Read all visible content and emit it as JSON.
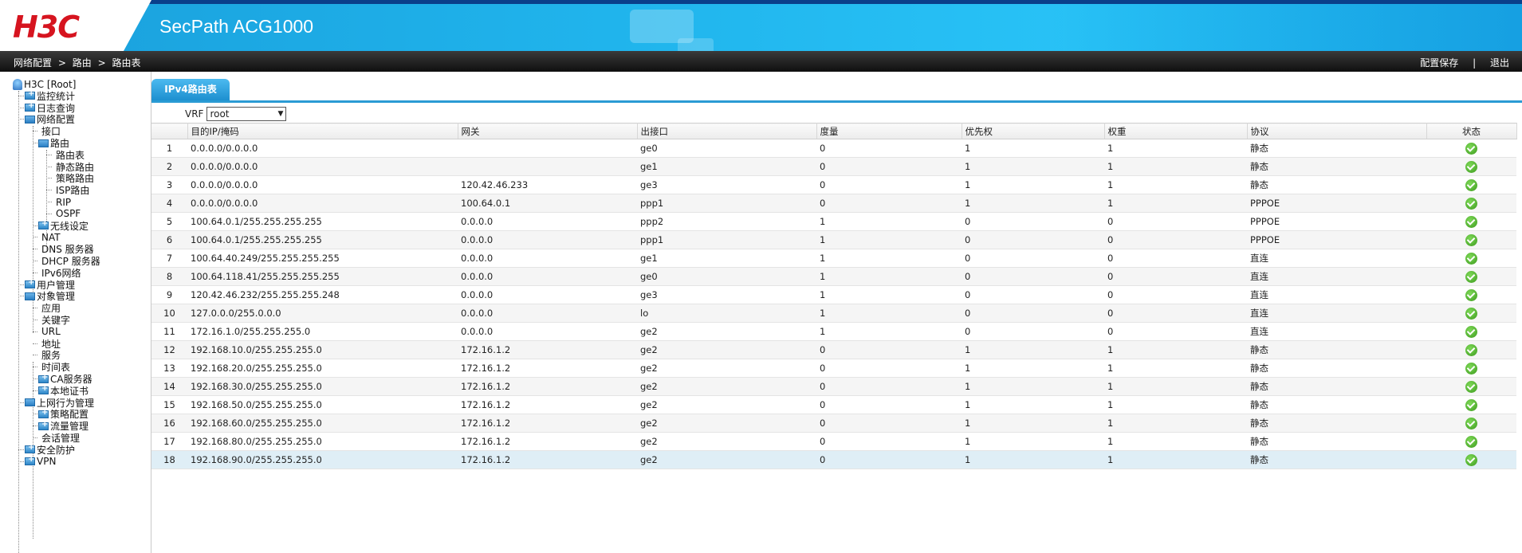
{
  "header": {
    "logo": "H3C",
    "product": "SecPath ACG1000"
  },
  "navbar": {
    "breadcrumb": [
      "网络配置",
      "路由",
      "路由表"
    ],
    "breadcrumb_sep": ">",
    "save_config": "配置保存",
    "divider": "|",
    "logout": "退出"
  },
  "sidebar": {
    "items": [
      {
        "label": "H3C [Root]",
        "icon": "root-icon"
      },
      {
        "label": "监控统计",
        "icon": "folder-plus-icon"
      },
      {
        "label": "日志查询",
        "icon": "folder-plus-icon"
      },
      {
        "label": "网络配置",
        "icon": "folder-open-icon"
      },
      {
        "label": "接口",
        "icon": "none"
      },
      {
        "label": "路由",
        "icon": "folder-open-icon"
      },
      {
        "label": "路由表",
        "icon": "none"
      },
      {
        "label": "静态路由",
        "icon": "none"
      },
      {
        "label": "策略路由",
        "icon": "none"
      },
      {
        "label": "ISP路由",
        "icon": "none"
      },
      {
        "label": "RIP",
        "icon": "none"
      },
      {
        "label": "OSPF",
        "icon": "none"
      },
      {
        "label": "无线设定",
        "icon": "folder-plus-icon"
      },
      {
        "label": "NAT",
        "icon": "none"
      },
      {
        "label": "DNS 服务器",
        "icon": "none"
      },
      {
        "label": "DHCP 服务器",
        "icon": "none"
      },
      {
        "label": "IPv6网络",
        "icon": "none"
      },
      {
        "label": "用户管理",
        "icon": "folder-plus-icon"
      },
      {
        "label": "对象管理",
        "icon": "folder-open-icon"
      },
      {
        "label": "应用",
        "icon": "none"
      },
      {
        "label": "关键字",
        "icon": "none"
      },
      {
        "label": "URL",
        "icon": "none"
      },
      {
        "label": "地址",
        "icon": "none"
      },
      {
        "label": "服务",
        "icon": "none"
      },
      {
        "label": "时间表",
        "icon": "none"
      },
      {
        "label": "CA服务器",
        "icon": "folder-plus-icon"
      },
      {
        "label": "本地证书",
        "icon": "folder-plus-icon"
      },
      {
        "label": "上网行为管理",
        "icon": "folder-open-icon"
      },
      {
        "label": "策略配置",
        "icon": "folder-plus-icon"
      },
      {
        "label": "流量管理",
        "icon": "folder-plus-icon"
      },
      {
        "label": "会话管理",
        "icon": "none"
      },
      {
        "label": "安全防护",
        "icon": "folder-plus-icon"
      },
      {
        "label": "VPN",
        "icon": "folder-plus-icon"
      }
    ]
  },
  "tab": {
    "label": "IPv4路由表"
  },
  "vrf": {
    "label": "VRF",
    "selected": "root"
  },
  "table": {
    "columns": [
      "",
      "目的IP/掩码",
      "网关",
      "出接口",
      "度量",
      "优先权",
      "权重",
      "协议",
      "状态"
    ],
    "rows": [
      [
        "1",
        "0.0.0.0/0.0.0.0",
        "",
        "ge0",
        "0",
        "1",
        "1",
        "静态"
      ],
      [
        "2",
        "0.0.0.0/0.0.0.0",
        "",
        "ge1",
        "0",
        "1",
        "1",
        "静态"
      ],
      [
        "3",
        "0.0.0.0/0.0.0.0",
        "120.42.46.233",
        "ge3",
        "0",
        "1",
        "1",
        "静态"
      ],
      [
        "4",
        "0.0.0.0/0.0.0.0",
        "100.64.0.1",
        "ppp1",
        "0",
        "1",
        "1",
        "PPPOE"
      ],
      [
        "5",
        "100.64.0.1/255.255.255.255",
        "0.0.0.0",
        "ppp2",
        "1",
        "0",
        "0",
        "PPPOE"
      ],
      [
        "6",
        "100.64.0.1/255.255.255.255",
        "0.0.0.0",
        "ppp1",
        "1",
        "0",
        "0",
        "PPPOE"
      ],
      [
        "7",
        "100.64.40.249/255.255.255.255",
        "0.0.0.0",
        "ge1",
        "1",
        "0",
        "0",
        "直连"
      ],
      [
        "8",
        "100.64.118.41/255.255.255.255",
        "0.0.0.0",
        "ge0",
        "1",
        "0",
        "0",
        "直连"
      ],
      [
        "9",
        "120.42.46.232/255.255.255.248",
        "0.0.0.0",
        "ge3",
        "1",
        "0",
        "0",
        "直连"
      ],
      [
        "10",
        "127.0.0.0/255.0.0.0",
        "0.0.0.0",
        "lo",
        "1",
        "0",
        "0",
        "直连"
      ],
      [
        "11",
        "172.16.1.0/255.255.255.0",
        "0.0.0.0",
        "ge2",
        "1",
        "0",
        "0",
        "直连"
      ],
      [
        "12",
        "192.168.10.0/255.255.255.0",
        "172.16.1.2",
        "ge2",
        "0",
        "1",
        "1",
        "静态"
      ],
      [
        "13",
        "192.168.20.0/255.255.255.0",
        "172.16.1.2",
        "ge2",
        "0",
        "1",
        "1",
        "静态"
      ],
      [
        "14",
        "192.168.30.0/255.255.255.0",
        "172.16.1.2",
        "ge2",
        "0",
        "1",
        "1",
        "静态"
      ],
      [
        "15",
        "192.168.50.0/255.255.255.0",
        "172.16.1.2",
        "ge2",
        "0",
        "1",
        "1",
        "静态"
      ],
      [
        "16",
        "192.168.60.0/255.255.255.0",
        "172.16.1.2",
        "ge2",
        "0",
        "1",
        "1",
        "静态"
      ],
      [
        "17",
        "192.168.80.0/255.255.255.0",
        "172.16.1.2",
        "ge2",
        "0",
        "1",
        "1",
        "静态"
      ],
      [
        "18",
        "192.168.90.0/255.255.255.0",
        "172.16.1.2",
        "ge2",
        "0",
        "1",
        "1",
        "静态"
      ]
    ],
    "status_icon": "check-circle-icon",
    "selected_row": 18
  },
  "colors": {
    "header_blue": "#20b4ec",
    "logo_red": "#d6141f",
    "tab_blue": "#2a9bd4",
    "status_green": "#4caf28"
  }
}
